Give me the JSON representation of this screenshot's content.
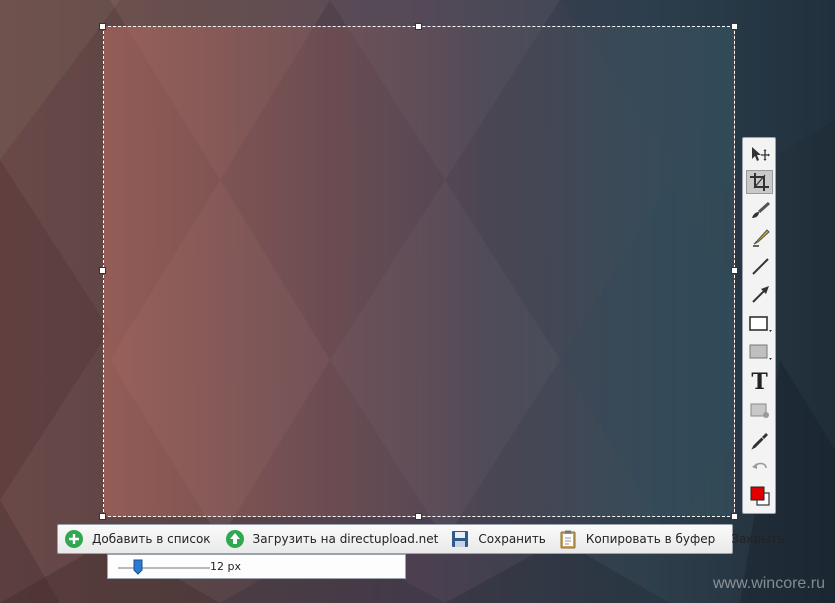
{
  "toolbar": {
    "tools": [
      {
        "name": "move"
      },
      {
        "name": "crop"
      },
      {
        "name": "brush"
      },
      {
        "name": "marker"
      },
      {
        "name": "line"
      },
      {
        "name": "arrow"
      },
      {
        "name": "rectangle-outline"
      },
      {
        "name": "rectangle-filled"
      },
      {
        "name": "text",
        "glyph": "T"
      },
      {
        "name": "blur"
      },
      {
        "name": "eyedropper"
      },
      {
        "name": "undo"
      },
      {
        "name": "color-picker"
      }
    ],
    "active_color": "#e00000"
  },
  "bottom_bar": {
    "add_to_list": "Добавить в список",
    "upload": "Загрузить на directupload.net",
    "save": "Сохранить",
    "copy": "Копировать в буфер",
    "close": "Закрыть"
  },
  "sub_bar": {
    "size_value": "12 px",
    "size_fraction": 0.22
  },
  "watermark": "www.wincore.ru"
}
